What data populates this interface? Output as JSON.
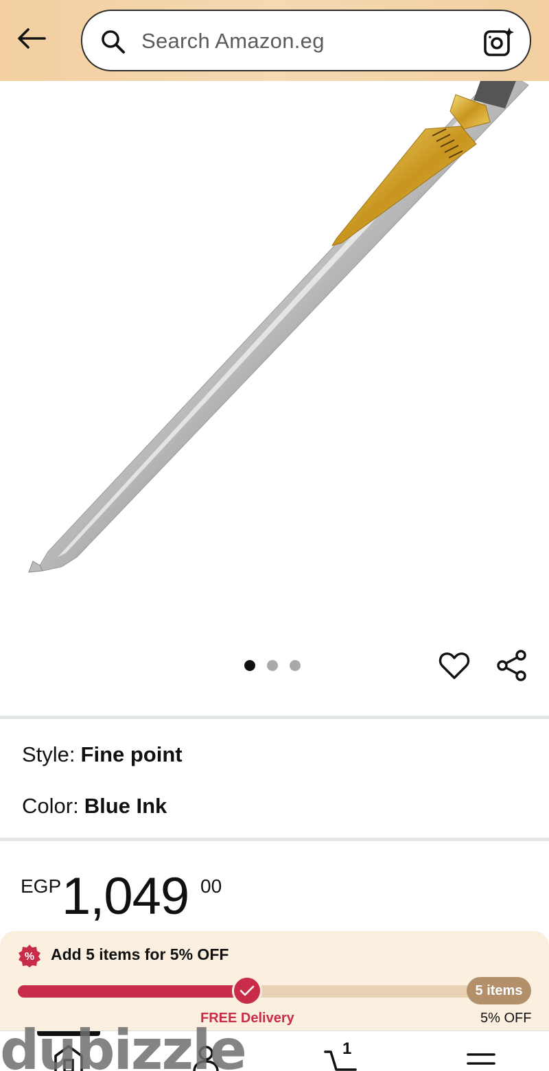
{
  "header": {
    "search_placeholder": "Search Amazon.eg"
  },
  "product": {
    "image_count": 3,
    "active_image": 1,
    "style_label": "Style:",
    "style_value": "Fine point",
    "color_label": "Color:",
    "color_value": "Blue Ink"
  },
  "price": {
    "currency": "EGP",
    "whole": "1,049",
    "fraction": "00"
  },
  "promo": {
    "badge": "%",
    "title": "Add 5 items for 5% OFF",
    "progress_percent": 47,
    "milestone_label": "FREE Delivery",
    "end_badge": "5 items",
    "end_label": "5% OFF"
  },
  "nav": {
    "cart_count": "1"
  },
  "watermark": "dubizzle",
  "colors": {
    "header_bg": "#f3cfa0",
    "promo_red": "#c92c48",
    "promo_bg": "#fbefe0",
    "badge_tan": "#b3906a"
  }
}
